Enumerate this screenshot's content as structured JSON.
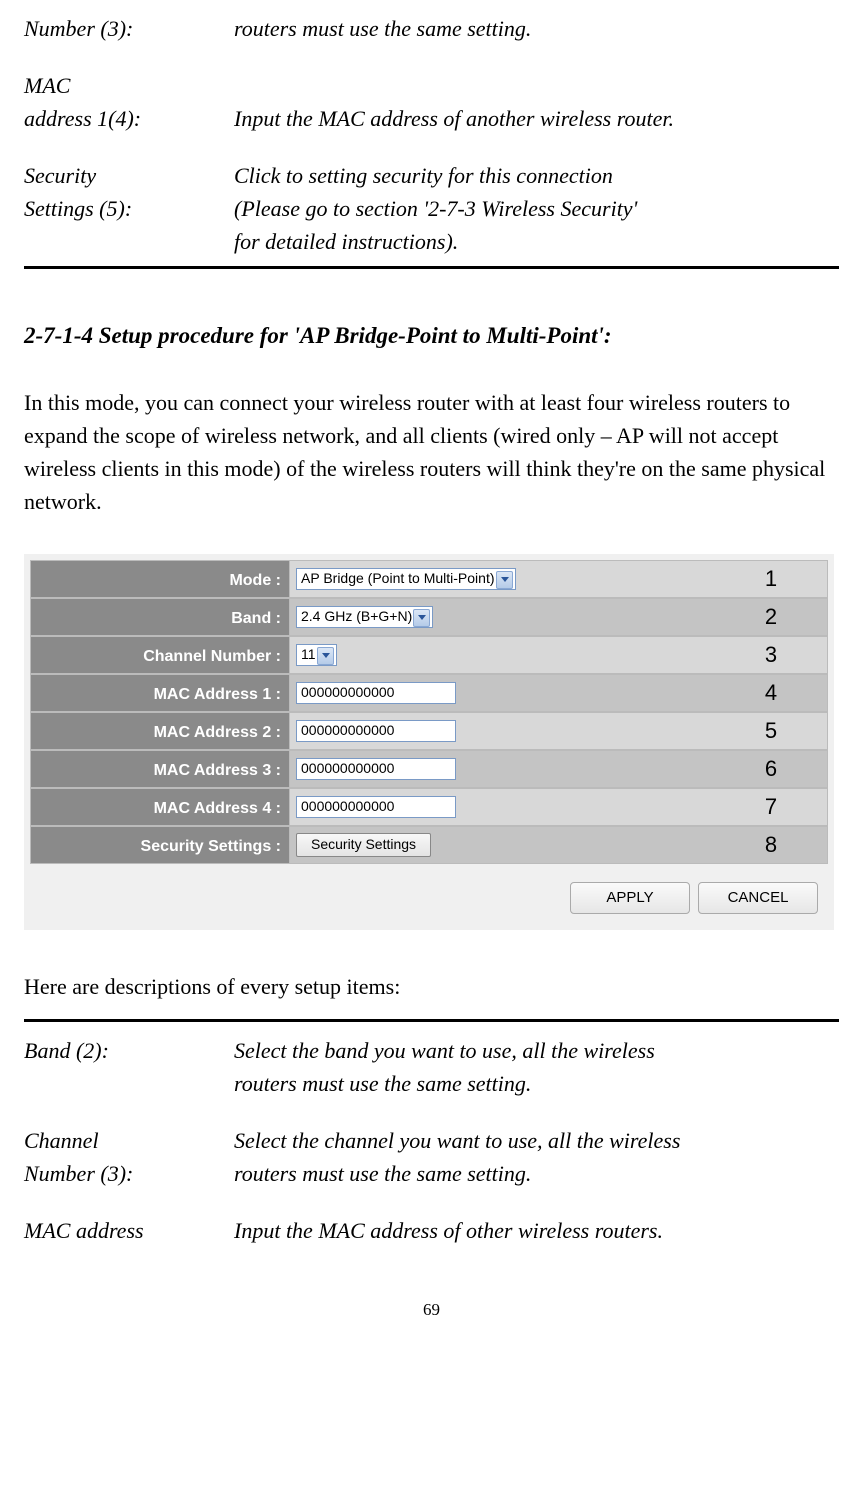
{
  "top_defs": [
    {
      "label_lines": [
        "Number (3):"
      ],
      "value_lines": [
        "routers must use the same setting."
      ]
    },
    {
      "label_lines": [
        "MAC",
        "address 1(4):"
      ],
      "value_lines": [
        "",
        "Input the MAC address of another wireless router."
      ]
    },
    {
      "label_lines": [
        "Security",
        "Settings (5):"
      ],
      "value_lines": [
        "Click to setting security for this connection",
        "(Please go to section '2-7-3 Wireless Security'",
        "for detailed instructions)."
      ]
    }
  ],
  "section_title": "2-7-1-4 Setup procedure for 'AP Bridge-Point to Multi-Point':",
  "body_text": "In this mode, you can connect your wireless router with at least four wireless routers to expand the scope of wireless network, and all clients (wired only – AP will not accept wireless clients in this mode) of the wireless routers will think they're on the same physical network.",
  "figure": {
    "rows": [
      {
        "label": "Mode :",
        "type": "select",
        "value": "AP Bridge (Point to Multi-Point)",
        "annot": "1",
        "alt": false
      },
      {
        "label": "Band :",
        "type": "select",
        "value": "2.4 GHz (B+G+N)",
        "annot": "2",
        "alt": true
      },
      {
        "label": "Channel Number :",
        "type": "select",
        "value": "11",
        "annot": "3",
        "alt": false
      },
      {
        "label": "MAC Address 1 :",
        "type": "input",
        "value": "000000000000",
        "annot": "4",
        "alt": true
      },
      {
        "label": "MAC Address 2 :",
        "type": "input",
        "value": "000000000000",
        "annot": "5",
        "alt": false
      },
      {
        "label": "MAC Address 3 :",
        "type": "input",
        "value": "000000000000",
        "annot": "6",
        "alt": true
      },
      {
        "label": "MAC Address 4 :",
        "type": "input",
        "value": "000000000000",
        "annot": "7",
        "alt": false
      },
      {
        "label": "Security Settings :",
        "type": "button",
        "value": "Security Settings",
        "annot": "8",
        "alt": true
      }
    ],
    "apply": "APPLY",
    "cancel": "CANCEL"
  },
  "desc_intro": "Here are descriptions of every setup items:",
  "bottom_defs": [
    {
      "label_lines": [
        "Band (2):"
      ],
      "value_lines": [
        "Select the band you want to use, all the wireless",
        "routers must use the same setting."
      ]
    },
    {
      "label_lines": [
        "Channel",
        "Number (3):"
      ],
      "value_lines": [
        "Select the channel you want to use, all the wireless",
        "routers must use the same setting."
      ]
    },
    {
      "label_lines": [
        "MAC address"
      ],
      "value_lines": [
        "Input the MAC address of other wireless routers."
      ]
    }
  ],
  "page_number": "69"
}
